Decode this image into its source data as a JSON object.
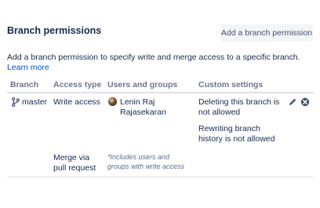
{
  "header": {
    "title": "Branch permissions",
    "add_button_label": "Add a branch permission"
  },
  "description": {
    "text": "Add a branch permission to specify write and merge access to a specific branch.",
    "link_text": "Learn more"
  },
  "table": {
    "columns": [
      "Branch",
      "Access type",
      "Users and groups",
      "Custom settings"
    ],
    "row": {
      "branch": "master",
      "access_write": "Write access",
      "user_name_line1": "Lenin Raj",
      "user_name_line2": "Rajasekaran",
      "setting_1": "Deleting this branch is not allowed",
      "setting_2": "Rewriting branch history is not allowed",
      "access_merge": "Merge via pull request",
      "merge_note": "*Includes users and groups with write access"
    }
  },
  "icons": {
    "branch": "branch-icon",
    "edit": "pencil-icon",
    "remove": "remove-icon"
  },
  "colors": {
    "link": "#0052cc",
    "text": "#172b4d",
    "muted": "#6b778c",
    "button_bg": "#f4f5f7"
  }
}
